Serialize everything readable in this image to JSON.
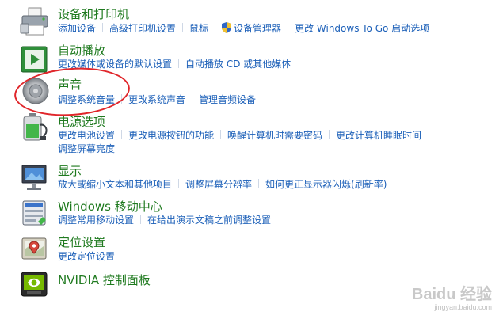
{
  "rows": {
    "devices": {
      "title": "设备和打印机",
      "links": [
        "添加设备",
        "高级打印机设置",
        "鼠标",
        "设备管理器",
        "更改 Windows To Go 启动选项"
      ]
    },
    "autoplay": {
      "title": "自动播放",
      "links": [
        "更改媒体或设备的默认设置",
        "自动播放 CD 或其他媒体"
      ]
    },
    "sound": {
      "title": "声音",
      "links": [
        "调整系统音量",
        "更改系统声音",
        "管理音频设备"
      ]
    },
    "power": {
      "title": "电源选项",
      "links": [
        "更改电池设置",
        "更改电源按钮的功能",
        "唤醒计算机时需要密码",
        "更改计算机睡眠时间",
        "调整屏幕亮度"
      ]
    },
    "display": {
      "title": "显示",
      "links": [
        "放大或缩小文本和其他项目",
        "调整屏幕分辨率",
        "如何更正显示器闪烁(刷新率)"
      ]
    },
    "mobility": {
      "title": "Windows 移动中心",
      "links": [
        "调整常用移动设置",
        "在给出演示文稿之前调整设置"
      ]
    },
    "location": {
      "title": "定位设置",
      "links": [
        "更改定位设置"
      ]
    },
    "nvidia": {
      "title": "NVIDIA 控制面板"
    }
  },
  "watermark": {
    "brand": "Baidu 经验",
    "url": "jingyan.baidu.com"
  },
  "colors": {
    "title_green": "#1f7a1f",
    "link_blue": "#1b5fb8",
    "annotation_red": "#e0262b"
  },
  "icons": {
    "devices": "printer-icon",
    "autoplay": "autoplay-icon",
    "sound": "speaker-icon",
    "power": "battery-icon",
    "display": "monitor-icon",
    "mobility": "mobility-center-icon",
    "location": "location-icon",
    "nvidia": "nvidia-icon"
  }
}
